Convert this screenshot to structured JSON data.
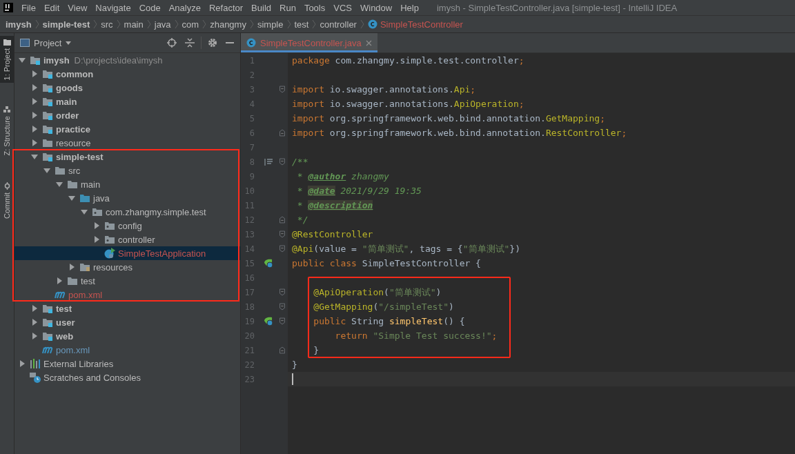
{
  "window": {
    "title": "imysh - SimpleTestController.java [simple-test] - IntelliJ IDEA"
  },
  "menu": [
    "File",
    "Edit",
    "View",
    "Navigate",
    "Code",
    "Analyze",
    "Refactor",
    "Build",
    "Run",
    "Tools",
    "VCS",
    "Window",
    "Help"
  ],
  "breadcrumbs": [
    {
      "label": "imysh",
      "kind": "project"
    },
    {
      "label": "simple-test",
      "kind": "module"
    },
    {
      "label": "src",
      "kind": "folder"
    },
    {
      "label": "main",
      "kind": "folder"
    },
    {
      "label": "java",
      "kind": "folder"
    },
    {
      "label": "com",
      "kind": "folder"
    },
    {
      "label": "zhangmy",
      "kind": "folder"
    },
    {
      "label": "simple",
      "kind": "folder"
    },
    {
      "label": "test",
      "kind": "folder"
    },
    {
      "label": "controller",
      "kind": "folder"
    },
    {
      "label": "SimpleTestController",
      "kind": "class"
    }
  ],
  "tool_strip": [
    {
      "label": "1: Project",
      "kind": "project",
      "selected": true
    },
    {
      "label": "Z: Structure",
      "kind": "structure",
      "selected": false
    },
    {
      "label": "Commit",
      "kind": "commit",
      "selected": false
    }
  ],
  "project_panel": {
    "title": "Project"
  },
  "tree": {
    "items": [
      {
        "label": "imysh",
        "detail": "D:\\projects\\idea\\imysh",
        "kind": "module",
        "expanded": true,
        "children": [
          {
            "label": "common",
            "kind": "module",
            "expanded": false
          },
          {
            "label": "goods",
            "kind": "module",
            "expanded": false
          },
          {
            "label": "main",
            "kind": "module",
            "expanded": false
          },
          {
            "label": "order",
            "kind": "module",
            "expanded": false
          },
          {
            "label": "practice",
            "kind": "module",
            "expanded": false
          },
          {
            "label": "resource",
            "kind": "folder",
            "expanded": false
          },
          {
            "label": "simple-test",
            "kind": "module",
            "expanded": true,
            "highlighted": true,
            "children": [
              {
                "label": "src",
                "kind": "folder",
                "expanded": true,
                "children": [
                  {
                    "label": "main",
                    "kind": "folder",
                    "expanded": true,
                    "children": [
                      {
                        "label": "java",
                        "kind": "source",
                        "expanded": true,
                        "children": [
                          {
                            "label": "com.zhangmy.simple.test",
                            "kind": "package",
                            "expanded": true,
                            "children": [
                              {
                                "label": "config",
                                "kind": "package",
                                "expanded": false
                              },
                              {
                                "label": "controller",
                                "kind": "package",
                                "expanded": false
                              },
                              {
                                "label": "SimpleTestApplication",
                                "kind": "app",
                                "unversioned": true,
                                "selected": true
                              }
                            ]
                          }
                        ]
                      },
                      {
                        "label": "resources",
                        "kind": "resources",
                        "expanded": false
                      }
                    ]
                  },
                  {
                    "label": "test",
                    "kind": "folder",
                    "expanded": false
                  }
                ]
              },
              {
                "label": "pom.xml",
                "kind": "maven",
                "unversioned": true,
                "selected": false
              }
            ]
          },
          {
            "label": "test",
            "kind": "module",
            "expanded": false
          },
          {
            "label": "user",
            "kind": "module",
            "expanded": false
          },
          {
            "label": "web",
            "kind": "module",
            "expanded": false
          },
          {
            "label": "pom.xml",
            "kind": "maven",
            "modified": true,
            "selected": false
          }
        ]
      },
      {
        "label": "External Libraries",
        "kind": "libraries",
        "expanded": false
      },
      {
        "label": "Scratches and Consoles",
        "kind": "scratches"
      }
    ]
  },
  "editor_tabs": [
    {
      "label": "SimpleTestController.java",
      "unversioned": true,
      "selected": true
    }
  ],
  "code": [
    {
      "number": "1",
      "tokens": [
        {
          "kind": "kw",
          "text": "package"
        },
        {
          "kind": "plain",
          "text": " com.zhangmy.simple.test.controller"
        },
        {
          "kind": "kw",
          "text": ";"
        }
      ]
    },
    {
      "number": "2"
    },
    {
      "number": "3",
      "fold_start": true,
      "tokens": [
        {
          "kind": "kw",
          "text": "import"
        },
        {
          "kind": "plain",
          "text": " io.swagger.annotations."
        },
        {
          "kind": "ann",
          "text": "Api"
        },
        {
          "kind": "kw",
          "text": ";"
        }
      ]
    },
    {
      "number": "4",
      "tokens": [
        {
          "kind": "kw",
          "text": "import"
        },
        {
          "kind": "plain",
          "text": " io.swagger.annotations."
        },
        {
          "kind": "ann",
          "text": "ApiOperation"
        },
        {
          "kind": "kw",
          "text": ";"
        }
      ]
    },
    {
      "number": "5",
      "tokens": [
        {
          "kind": "kw",
          "text": "import"
        },
        {
          "kind": "plain",
          "text": " org.springframework.web.bind.annotation."
        },
        {
          "kind": "ann",
          "text": "GetMapping"
        },
        {
          "kind": "kw",
          "text": ";"
        }
      ]
    },
    {
      "number": "6",
      "fold_end": true,
      "tokens": [
        {
          "kind": "kw",
          "text": "import"
        },
        {
          "kind": "plain",
          "text": " org.springframework.web.bind.annotation."
        },
        {
          "kind": "ann",
          "text": "RestController"
        },
        {
          "kind": "kw",
          "text": ";"
        }
      ]
    },
    {
      "number": "7"
    },
    {
      "number": "8",
      "fold_start": true,
      "doc_icon": true,
      "tokens": [
        {
          "kind": "cmt",
          "text": "/**"
        }
      ]
    },
    {
      "number": "9",
      "tokens": [
        {
          "kind": "cmt",
          "text": " * "
        },
        {
          "kind": "tag",
          "text": "@author"
        },
        {
          "kind": "cmt",
          "text": " zhangmy"
        }
      ]
    },
    {
      "number": "10",
      "tokens": [
        {
          "kind": "cmt",
          "text": " * "
        },
        {
          "kind": "tag_marked",
          "text": "@date"
        },
        {
          "kind": "cmt",
          "text": " 2021/9/29 19:35"
        }
      ]
    },
    {
      "number": "11",
      "tokens": [
        {
          "kind": "cmt",
          "text": " * "
        },
        {
          "kind": "tag_marked",
          "text": "@description"
        }
      ]
    },
    {
      "number": "12",
      "fold_end": true,
      "tokens": [
        {
          "kind": "cmt",
          "text": " */"
        }
      ]
    },
    {
      "number": "13",
      "fold_start": true,
      "tokens": [
        {
          "kind": "ann",
          "text": "@RestController"
        }
      ]
    },
    {
      "number": "14",
      "fold_start": true,
      "tokens": [
        {
          "kind": "ann",
          "text": "@Api"
        },
        {
          "kind": "plain",
          "text": "(value = "
        },
        {
          "kind": "str",
          "text": "\"简单测试\""
        },
        {
          "kind": "plain",
          "text": ", tags = {"
        },
        {
          "kind": "str",
          "text": "\"简单测试\""
        },
        {
          "kind": "plain",
          "text": "})"
        }
      ]
    },
    {
      "number": "15",
      "bean_icon": true,
      "tokens": [
        {
          "kind": "kw",
          "text": "public class"
        },
        {
          "kind": "plain",
          "text": " SimpleTestController {"
        }
      ]
    },
    {
      "number": "16"
    },
    {
      "number": "17",
      "fold_start": true,
      "highlighted": true,
      "tokens": [
        {
          "kind": "ann",
          "text": "    @ApiOperation"
        },
        {
          "kind": "plain",
          "text": "("
        },
        {
          "kind": "str",
          "text": "\"简单测试\""
        },
        {
          "kind": "plain",
          "text": ")"
        }
      ]
    },
    {
      "number": "18",
      "fold_start": true,
      "highlighted": true,
      "tokens": [
        {
          "kind": "ann",
          "text": "    @GetMapping"
        },
        {
          "kind": "plain",
          "text": "("
        },
        {
          "kind": "str",
          "text": "\"/simpleTest\""
        },
        {
          "kind": "plain",
          "text": ")"
        }
      ]
    },
    {
      "number": "19",
      "fold_start": true,
      "bean_icon": true,
      "highlighted": true,
      "tokens": [
        {
          "kind": "kw",
          "text": "    public"
        },
        {
          "kind": "plain",
          "text": " String "
        },
        {
          "kind": "method",
          "text": "simpleTest"
        },
        {
          "kind": "plain",
          "text": "() {"
        }
      ]
    },
    {
      "number": "20",
      "highlighted": true,
      "tokens": [
        {
          "kind": "kw",
          "text": "        return"
        },
        {
          "kind": "str",
          "text": " \"Simple Test success!\""
        },
        {
          "kind": "kw",
          "text": ";"
        }
      ]
    },
    {
      "number": "21",
      "fold_end": true,
      "highlighted": true,
      "tokens": [
        {
          "kind": "plain",
          "text": "    }"
        }
      ]
    },
    {
      "number": "22",
      "tokens": [
        {
          "kind": "plain",
          "text": "}"
        }
      ]
    },
    {
      "number": "23",
      "current": true
    }
  ]
}
